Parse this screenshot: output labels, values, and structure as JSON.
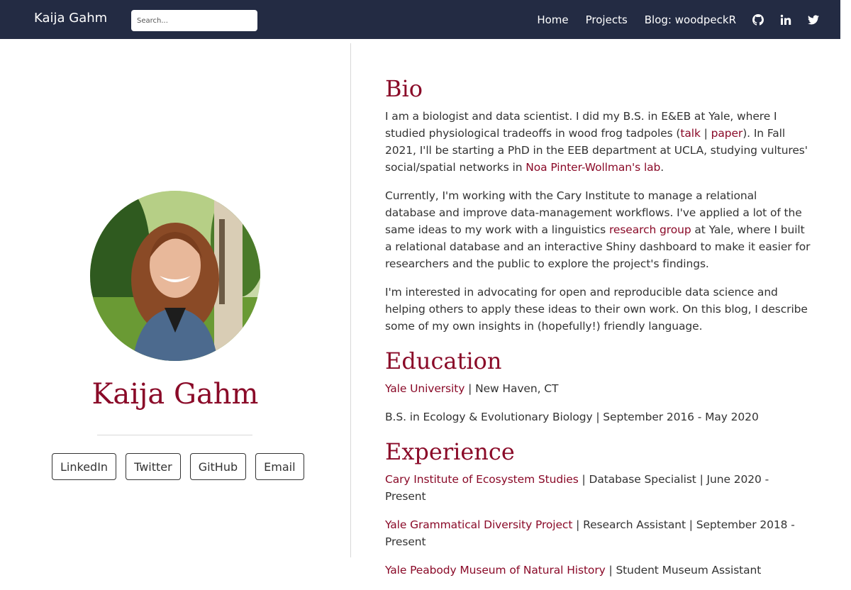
{
  "navbar": {
    "brand": "Kaija Gahm",
    "search_placeholder": "Search...",
    "links": [
      "Home",
      "Projects",
      "Blog: woodpeckR"
    ],
    "icons": [
      "github-icon",
      "linkedin-icon",
      "twitter-icon"
    ]
  },
  "profile": {
    "name": "Kaija Gahm",
    "buttons": [
      "LinkedIn",
      "Twitter",
      "GitHub",
      "Email"
    ]
  },
  "bio": {
    "title": "Bio",
    "p1": {
      "t1": "I am a biologist and data scientist. I did my B.S. in E&EB at Yale, where I studied physiological tradeoffs in wood frog tadpoles (",
      "link1": "talk",
      "sep": " | ",
      "link2": "paper",
      "t2": "). In Fall 2021, I'll be starting a PhD in the EEB department at UCLA, studying vultures' social/spatial networks in ",
      "link3": "Noa Pinter-Wollman's lab",
      "t3": "."
    },
    "p2": {
      "t1": "Currently, I'm working with the Cary Institute to manage a relational database and improve data-management workflows. I've applied a lot of the same ideas to my work with a linguistics ",
      "link1": "research group",
      "t2": " at Yale, where I built a relational database and an interactive Shiny dashboard to make it easier for researchers and the public to explore the project's findings."
    },
    "p3": "I'm interested in advocating for open and reproducible data science and helping others to apply these ideas to their own work. On this blog, I describe some of my own insights in (hopefully!) friendly language."
  },
  "education": {
    "title": "Education",
    "school": "Yale University",
    "location": " | New Haven, CT",
    "degree": "B.S. in Ecology & Evolutionary Biology | September 2016 - May 2020"
  },
  "experience": {
    "title": "Experience",
    "items": [
      {
        "org": "Cary Institute of Ecosystem Studies",
        "rest": " | Database Specialist | June 2020 - Present"
      },
      {
        "org": "Yale Grammatical Diversity Project",
        "rest": " | Research Assistant | September 2018 - Present"
      },
      {
        "org": "Yale Peabody Museum of Natural History",
        "rest": " | Student Museum Assistant"
      }
    ]
  },
  "colors": {
    "navbar": "#232b43",
    "accent": "#8a0a28",
    "text": "#333333"
  }
}
